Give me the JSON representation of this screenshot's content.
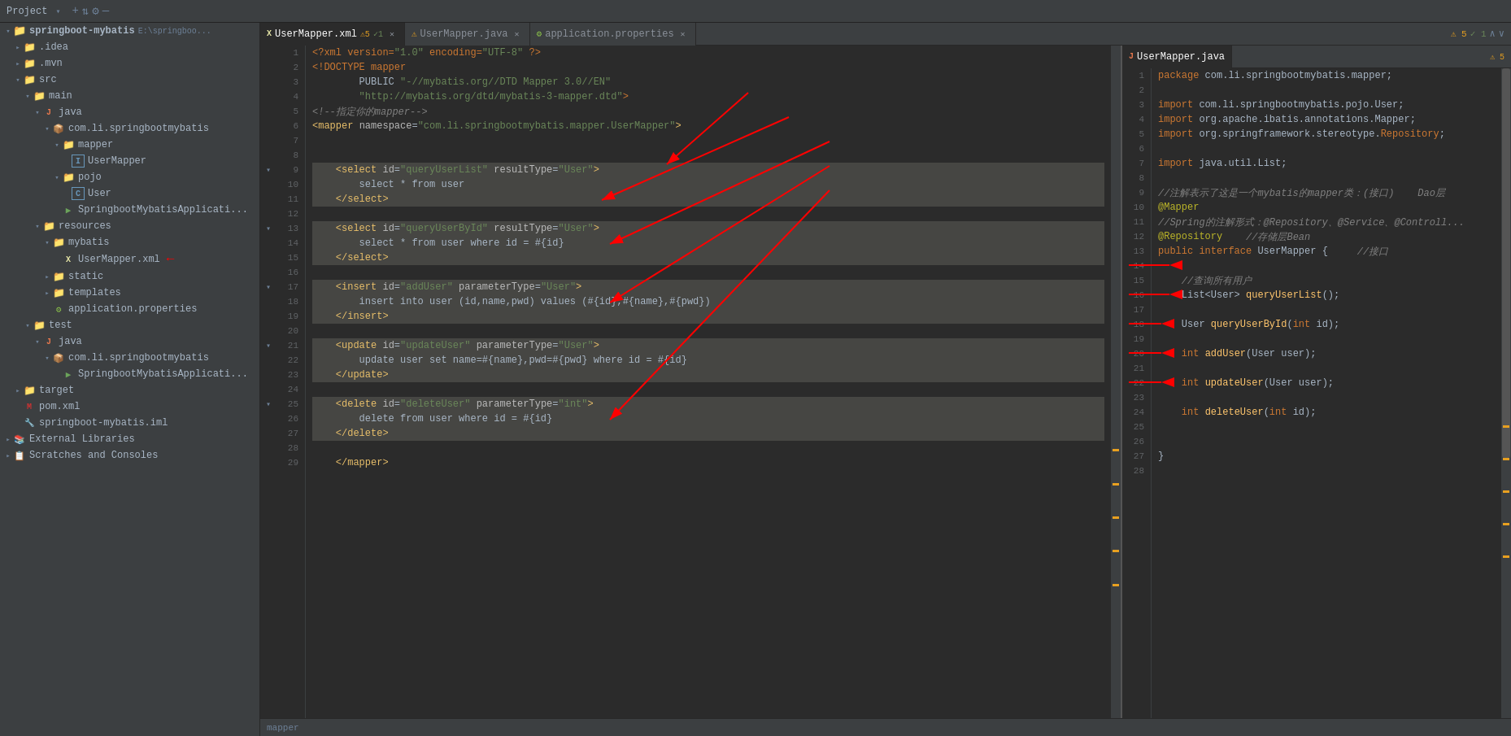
{
  "titleBar": {
    "projectLabel": "Project",
    "icons": [
      "+",
      "⇅",
      "⚙",
      "—"
    ]
  },
  "sidebar": {
    "items": [
      {
        "id": "springboot-mybatis",
        "label": "springboot-mybatis",
        "sublabel": "E:\\springboo...",
        "indent": 0,
        "type": "module",
        "arrow": "open"
      },
      {
        "id": "idea",
        "label": ".idea",
        "indent": 1,
        "type": "folder",
        "arrow": "closed"
      },
      {
        "id": "mvn",
        "label": ".mvn",
        "indent": 1,
        "type": "folder",
        "arrow": "closed"
      },
      {
        "id": "src",
        "label": "src",
        "indent": 1,
        "type": "folder",
        "arrow": "open"
      },
      {
        "id": "main",
        "label": "main",
        "indent": 2,
        "type": "folder",
        "arrow": "open"
      },
      {
        "id": "java",
        "label": "java",
        "indent": 3,
        "type": "folder-java",
        "arrow": "open"
      },
      {
        "id": "com.li.springbootmybatis",
        "label": "com.li.springbootmybatis",
        "indent": 4,
        "type": "package",
        "arrow": "open"
      },
      {
        "id": "mapper",
        "label": "mapper",
        "indent": 5,
        "type": "folder",
        "arrow": "open"
      },
      {
        "id": "UserMapper-java",
        "label": "UserMapper",
        "indent": 6,
        "type": "interface",
        "arrow": "leaf"
      },
      {
        "id": "pojo",
        "label": "pojo",
        "indent": 5,
        "type": "folder",
        "arrow": "open"
      },
      {
        "id": "User",
        "label": "User",
        "indent": 6,
        "type": "class",
        "arrow": "leaf"
      },
      {
        "id": "SpringbootMybatisApplication",
        "label": "SpringbootMybatisApplicati...",
        "indent": 5,
        "type": "class",
        "arrow": "leaf"
      },
      {
        "id": "resources",
        "label": "resources",
        "indent": 3,
        "type": "folder-resources",
        "arrow": "open"
      },
      {
        "id": "mybatis",
        "label": "mybatis",
        "indent": 4,
        "type": "folder-brown",
        "arrow": "open"
      },
      {
        "id": "UserMapper-xml",
        "label": "UserMapper.xml",
        "indent": 5,
        "type": "xml",
        "arrow": "leaf"
      },
      {
        "id": "static",
        "label": "static",
        "indent": 4,
        "type": "folder",
        "arrow": "closed"
      },
      {
        "id": "templates",
        "label": "templates",
        "indent": 4,
        "type": "folder",
        "arrow": "closed"
      },
      {
        "id": "application.properties",
        "label": "application.properties",
        "indent": 4,
        "type": "properties",
        "arrow": "leaf"
      },
      {
        "id": "test",
        "label": "test",
        "indent": 2,
        "type": "folder",
        "arrow": "open"
      },
      {
        "id": "test-java",
        "label": "java",
        "indent": 3,
        "type": "folder-java",
        "arrow": "open"
      },
      {
        "id": "test-com",
        "label": "com.li.springbootmybatis",
        "indent": 4,
        "type": "package",
        "arrow": "open"
      },
      {
        "id": "test-app",
        "label": "SpringbootMybatisApplicati...",
        "indent": 5,
        "type": "class",
        "arrow": "leaf"
      },
      {
        "id": "target",
        "label": "target",
        "indent": 1,
        "type": "folder",
        "arrow": "closed"
      },
      {
        "id": "pom.xml",
        "label": "pom.xml",
        "indent": 1,
        "type": "xml",
        "arrow": "leaf"
      },
      {
        "id": "springboot-mybatis.iml",
        "label": "springboot-mybatis.iml",
        "indent": 1,
        "type": "iml",
        "arrow": "leaf"
      },
      {
        "id": "External Libraries",
        "label": "External Libraries",
        "indent": 0,
        "type": "ext",
        "arrow": "closed"
      },
      {
        "id": "Scratches and Consoles",
        "label": "Scratches and Consoles",
        "indent": 0,
        "type": "scratch",
        "arrow": "closed"
      }
    ]
  },
  "tabs": {
    "left": [
      {
        "id": "UserMapper.xml",
        "label": "UserMapper.xml",
        "type": "xml",
        "active": true,
        "warnings": "5",
        "checks": "1"
      },
      {
        "id": "UserMapper.java",
        "label": "UserMapper.java",
        "type": "java",
        "active": false
      },
      {
        "id": "application.properties",
        "label": "application.properties",
        "type": "properties",
        "active": false
      }
    ]
  },
  "rightTabs": {
    "items": [
      {
        "id": "UserMapper.java-right",
        "label": "UserMapper.java",
        "type": "java",
        "active": true,
        "warnings": "5"
      }
    ]
  },
  "xmlEditor": {
    "lines": [
      {
        "num": 1,
        "content": "<?xml version=\"1.0\" encoding=\"UTF-8\" ?>",
        "highlight": false
      },
      {
        "num": 2,
        "content": "<!DOCTYPE mapper",
        "highlight": false
      },
      {
        "num": 3,
        "content": "        PUBLIC \"-//mybatis.org//DTD Mapper 3.0//EN\"",
        "highlight": false
      },
      {
        "num": 4,
        "content": "        \"http://mybatis.org/dtd/mybatis-3-mapper.dtd\">",
        "highlight": false
      },
      {
        "num": 5,
        "content": "<!--指定你的mapper-->",
        "highlight": false
      },
      {
        "num": 6,
        "content": "<mapper namespace=\"com.li.springbootmybatis.mapper.UserMapper\">",
        "highlight": false
      },
      {
        "num": 7,
        "content": "",
        "highlight": false
      },
      {
        "num": 8,
        "content": "",
        "highlight": false
      },
      {
        "num": 9,
        "content": "    <select id=\"queryUserList\" resultType=\"User\">",
        "highlight": true
      },
      {
        "num": 10,
        "content": "        select * from user",
        "highlight": true
      },
      {
        "num": 11,
        "content": "    </select>",
        "highlight": true
      },
      {
        "num": 12,
        "content": "",
        "highlight": false
      },
      {
        "num": 13,
        "content": "    <select id=\"queryUserById\" resultType=\"User\">",
        "highlight": true
      },
      {
        "num": 14,
        "content": "        select * from user where id = #{id}",
        "highlight": true
      },
      {
        "num": 15,
        "content": "    </select>",
        "highlight": true
      },
      {
        "num": 16,
        "content": "",
        "highlight": false
      },
      {
        "num": 17,
        "content": "    <insert id=\"addUser\" parameterType=\"User\">",
        "highlight": true
      },
      {
        "num": 18,
        "content": "        insert into user (id,name,pwd) values (#{id},#{name},#{pwd})",
        "highlight": true
      },
      {
        "num": 19,
        "content": "    </insert>",
        "highlight": true
      },
      {
        "num": 20,
        "content": "",
        "highlight": false
      },
      {
        "num": 21,
        "content": "    <update id=\"updateUser\" parameterType=\"User\">",
        "highlight": true
      },
      {
        "num": 22,
        "content": "        update user set name=#{name},pwd=#{pwd} where id = #{id}",
        "highlight": true
      },
      {
        "num": 23,
        "content": "    </update>",
        "highlight": true
      },
      {
        "num": 24,
        "content": "",
        "highlight": false
      },
      {
        "num": 25,
        "content": "    <delete id=\"deleteUser\" parameterType=\"int\">",
        "highlight": true
      },
      {
        "num": 26,
        "content": "        delete from user where id = #{id}",
        "highlight": true
      },
      {
        "num": 27,
        "content": "    </delete>",
        "highlight": true
      },
      {
        "num": 28,
        "content": "",
        "highlight": false
      },
      {
        "num": 29,
        "content": "    </mapper>",
        "highlight": false
      }
    ]
  },
  "javaEditor": {
    "lines": [
      {
        "num": 1,
        "content": "package com.li.springbootmybatis.mapper;"
      },
      {
        "num": 2,
        "content": ""
      },
      {
        "num": 3,
        "content": "import com.li.springbootmybatis.pojo.User;"
      },
      {
        "num": 4,
        "content": "import org.apache.ibatis.annotations.Mapper;"
      },
      {
        "num": 5,
        "content": "import org.springframework.stereotype.Repository;"
      },
      {
        "num": 6,
        "content": ""
      },
      {
        "num": 7,
        "content": "import java.util.List;"
      },
      {
        "num": 8,
        "content": ""
      },
      {
        "num": 9,
        "content": "//注解表示了这是一个mybatis的mapper类：(接口)    Dao层"
      },
      {
        "num": 10,
        "content": "@Mapper"
      },
      {
        "num": 11,
        "content": "//Spring的注解形式：@Repository、@Service、@Controll..."
      },
      {
        "num": 12,
        "content": "@Repository    //存储层Bean"
      },
      {
        "num": 13,
        "content": "public interface UserMapper {    //接口"
      },
      {
        "num": 14,
        "content": ""
      },
      {
        "num": 15,
        "content": "    //查询所有用户"
      },
      {
        "num": 16,
        "content": "    List<User> queryUserList();"
      },
      {
        "num": 17,
        "content": ""
      },
      {
        "num": 18,
        "content": "    User queryUserById(int id);"
      },
      {
        "num": 19,
        "content": ""
      },
      {
        "num": 20,
        "content": "    int addUser(User user);"
      },
      {
        "num": 21,
        "content": ""
      },
      {
        "num": 22,
        "content": "    int updateUser(User user);"
      },
      {
        "num": 23,
        "content": ""
      },
      {
        "num": 24,
        "content": "    int deleteUser(int id);"
      },
      {
        "num": 25,
        "content": ""
      },
      {
        "num": 26,
        "content": ""
      },
      {
        "num": 27,
        "content": "}"
      },
      {
        "num": 28,
        "content": ""
      }
    ]
  }
}
